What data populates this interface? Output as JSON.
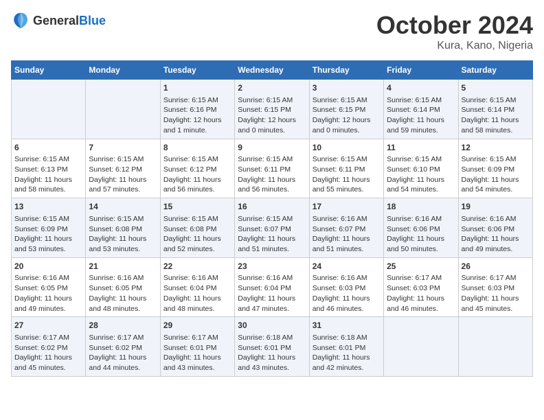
{
  "header": {
    "logo_general": "General",
    "logo_blue": "Blue",
    "month_title": "October 2024",
    "location": "Kura, Kano, Nigeria"
  },
  "columns": [
    "Sunday",
    "Monday",
    "Tuesday",
    "Wednesday",
    "Thursday",
    "Friday",
    "Saturday"
  ],
  "weeks": [
    [
      {
        "day": "",
        "content": ""
      },
      {
        "day": "",
        "content": ""
      },
      {
        "day": "1",
        "content": "Sunrise: 6:15 AM\nSunset: 6:16 PM\nDaylight: 12 hours and 1 minute."
      },
      {
        "day": "2",
        "content": "Sunrise: 6:15 AM\nSunset: 6:15 PM\nDaylight: 12 hours and 0 minutes."
      },
      {
        "day": "3",
        "content": "Sunrise: 6:15 AM\nSunset: 6:15 PM\nDaylight: 12 hours and 0 minutes."
      },
      {
        "day": "4",
        "content": "Sunrise: 6:15 AM\nSunset: 6:14 PM\nDaylight: 11 hours and 59 minutes."
      },
      {
        "day": "5",
        "content": "Sunrise: 6:15 AM\nSunset: 6:14 PM\nDaylight: 11 hours and 58 minutes."
      }
    ],
    [
      {
        "day": "6",
        "content": "Sunrise: 6:15 AM\nSunset: 6:13 PM\nDaylight: 11 hours and 58 minutes."
      },
      {
        "day": "7",
        "content": "Sunrise: 6:15 AM\nSunset: 6:12 PM\nDaylight: 11 hours and 57 minutes."
      },
      {
        "day": "8",
        "content": "Sunrise: 6:15 AM\nSunset: 6:12 PM\nDaylight: 11 hours and 56 minutes."
      },
      {
        "day": "9",
        "content": "Sunrise: 6:15 AM\nSunset: 6:11 PM\nDaylight: 11 hours and 56 minutes."
      },
      {
        "day": "10",
        "content": "Sunrise: 6:15 AM\nSunset: 6:11 PM\nDaylight: 11 hours and 55 minutes."
      },
      {
        "day": "11",
        "content": "Sunrise: 6:15 AM\nSunset: 6:10 PM\nDaylight: 11 hours and 54 minutes."
      },
      {
        "day": "12",
        "content": "Sunrise: 6:15 AM\nSunset: 6:09 PM\nDaylight: 11 hours and 54 minutes."
      }
    ],
    [
      {
        "day": "13",
        "content": "Sunrise: 6:15 AM\nSunset: 6:09 PM\nDaylight: 11 hours and 53 minutes."
      },
      {
        "day": "14",
        "content": "Sunrise: 6:15 AM\nSunset: 6:08 PM\nDaylight: 11 hours and 53 minutes."
      },
      {
        "day": "15",
        "content": "Sunrise: 6:15 AM\nSunset: 6:08 PM\nDaylight: 11 hours and 52 minutes."
      },
      {
        "day": "16",
        "content": "Sunrise: 6:15 AM\nSunset: 6:07 PM\nDaylight: 11 hours and 51 minutes."
      },
      {
        "day": "17",
        "content": "Sunrise: 6:16 AM\nSunset: 6:07 PM\nDaylight: 11 hours and 51 minutes."
      },
      {
        "day": "18",
        "content": "Sunrise: 6:16 AM\nSunset: 6:06 PM\nDaylight: 11 hours and 50 minutes."
      },
      {
        "day": "19",
        "content": "Sunrise: 6:16 AM\nSunset: 6:06 PM\nDaylight: 11 hours and 49 minutes."
      }
    ],
    [
      {
        "day": "20",
        "content": "Sunrise: 6:16 AM\nSunset: 6:05 PM\nDaylight: 11 hours and 49 minutes."
      },
      {
        "day": "21",
        "content": "Sunrise: 6:16 AM\nSunset: 6:05 PM\nDaylight: 11 hours and 48 minutes."
      },
      {
        "day": "22",
        "content": "Sunrise: 6:16 AM\nSunset: 6:04 PM\nDaylight: 11 hours and 48 minutes."
      },
      {
        "day": "23",
        "content": "Sunrise: 6:16 AM\nSunset: 6:04 PM\nDaylight: 11 hours and 47 minutes."
      },
      {
        "day": "24",
        "content": "Sunrise: 6:16 AM\nSunset: 6:03 PM\nDaylight: 11 hours and 46 minutes."
      },
      {
        "day": "25",
        "content": "Sunrise: 6:17 AM\nSunset: 6:03 PM\nDaylight: 11 hours and 46 minutes."
      },
      {
        "day": "26",
        "content": "Sunrise: 6:17 AM\nSunset: 6:03 PM\nDaylight: 11 hours and 45 minutes."
      }
    ],
    [
      {
        "day": "27",
        "content": "Sunrise: 6:17 AM\nSunset: 6:02 PM\nDaylight: 11 hours and 45 minutes."
      },
      {
        "day": "28",
        "content": "Sunrise: 6:17 AM\nSunset: 6:02 PM\nDaylight: 11 hours and 44 minutes."
      },
      {
        "day": "29",
        "content": "Sunrise: 6:17 AM\nSunset: 6:01 PM\nDaylight: 11 hours and 43 minutes."
      },
      {
        "day": "30",
        "content": "Sunrise: 6:18 AM\nSunset: 6:01 PM\nDaylight: 11 hours and 43 minutes."
      },
      {
        "day": "31",
        "content": "Sunrise: 6:18 AM\nSunset: 6:01 PM\nDaylight: 11 hours and 42 minutes."
      },
      {
        "day": "",
        "content": ""
      },
      {
        "day": "",
        "content": ""
      }
    ]
  ]
}
